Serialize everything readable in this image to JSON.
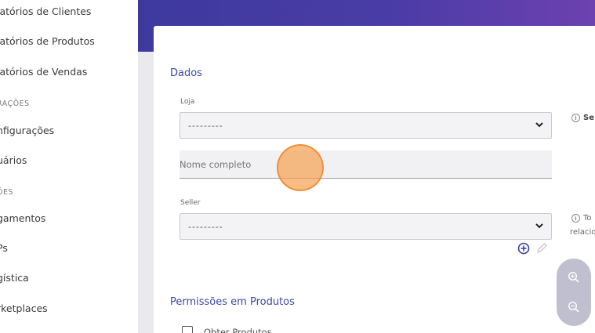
{
  "sidebar": {
    "items": [
      {
        "label": "latórios de Clientes"
      },
      {
        "label": "latórios de Produtos"
      },
      {
        "label": "latórios de Vendas"
      },
      {
        "label": "nfigurações"
      },
      {
        "label": "uários"
      },
      {
        "label": "gamentos"
      },
      {
        "label": "Ps"
      },
      {
        "label": "gística"
      },
      {
        "label": "rketplaces"
      }
    ],
    "sections": [
      {
        "label": "RAÇÕES"
      },
      {
        "label": "ÕES"
      }
    ]
  },
  "form": {
    "dados_title": "Dados",
    "loja": {
      "label": "Loja",
      "value": "---------",
      "hint": "Se"
    },
    "nome": {
      "placeholder": "Nome completo"
    },
    "seller": {
      "label": "Seller",
      "value": "---------",
      "hint_line1": "To",
      "hint_line2": "relacio"
    },
    "permissions_title": "Permissões em Produtos",
    "permission_items": [
      {
        "label": "Obter Produtos"
      }
    ]
  },
  "colors": {
    "header_start": "#3d3a9e",
    "header_end": "#6d41b0",
    "accent": "#3a4aa0"
  }
}
